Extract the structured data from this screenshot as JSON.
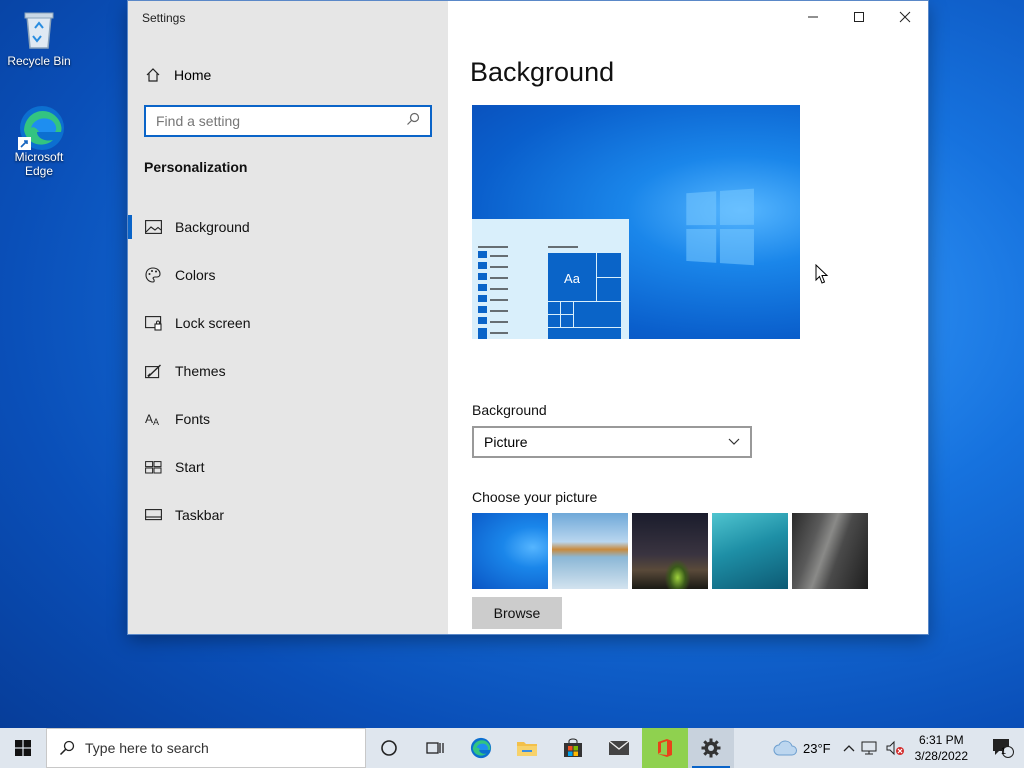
{
  "desktop": {
    "icons": [
      {
        "label": "Recycle Bin"
      },
      {
        "label": "Microsoft Edge"
      }
    ]
  },
  "window": {
    "title": "Settings",
    "home_label": "Home",
    "search_placeholder": "Find a setting",
    "section": "Personalization",
    "nav": [
      {
        "label": "Background",
        "icon": "picture-icon",
        "active": true
      },
      {
        "label": "Colors",
        "icon": "palette-icon"
      },
      {
        "label": "Lock screen",
        "icon": "lock-screen-icon"
      },
      {
        "label": "Themes",
        "icon": "themes-icon"
      },
      {
        "label": "Fonts",
        "icon": "fonts-icon"
      },
      {
        "label": "Start",
        "icon": "start-icon"
      },
      {
        "label": "Taskbar",
        "icon": "taskbar-icon"
      }
    ]
  },
  "main": {
    "title": "Background",
    "preview_sample_text": "Aa",
    "background_label": "Background",
    "background_value": "Picture",
    "choose_label": "Choose your picture",
    "browse_label": "Browse"
  },
  "taskbar": {
    "search_placeholder": "Type here to search",
    "weather": "23°F",
    "time": "6:31 PM",
    "date": "3/28/2022",
    "notification_count": "1"
  },
  "colors": {
    "accent": "#0a64c8",
    "sidebar_bg": "#e6e6e6",
    "taskbar_bg": "#dfe6ee"
  }
}
